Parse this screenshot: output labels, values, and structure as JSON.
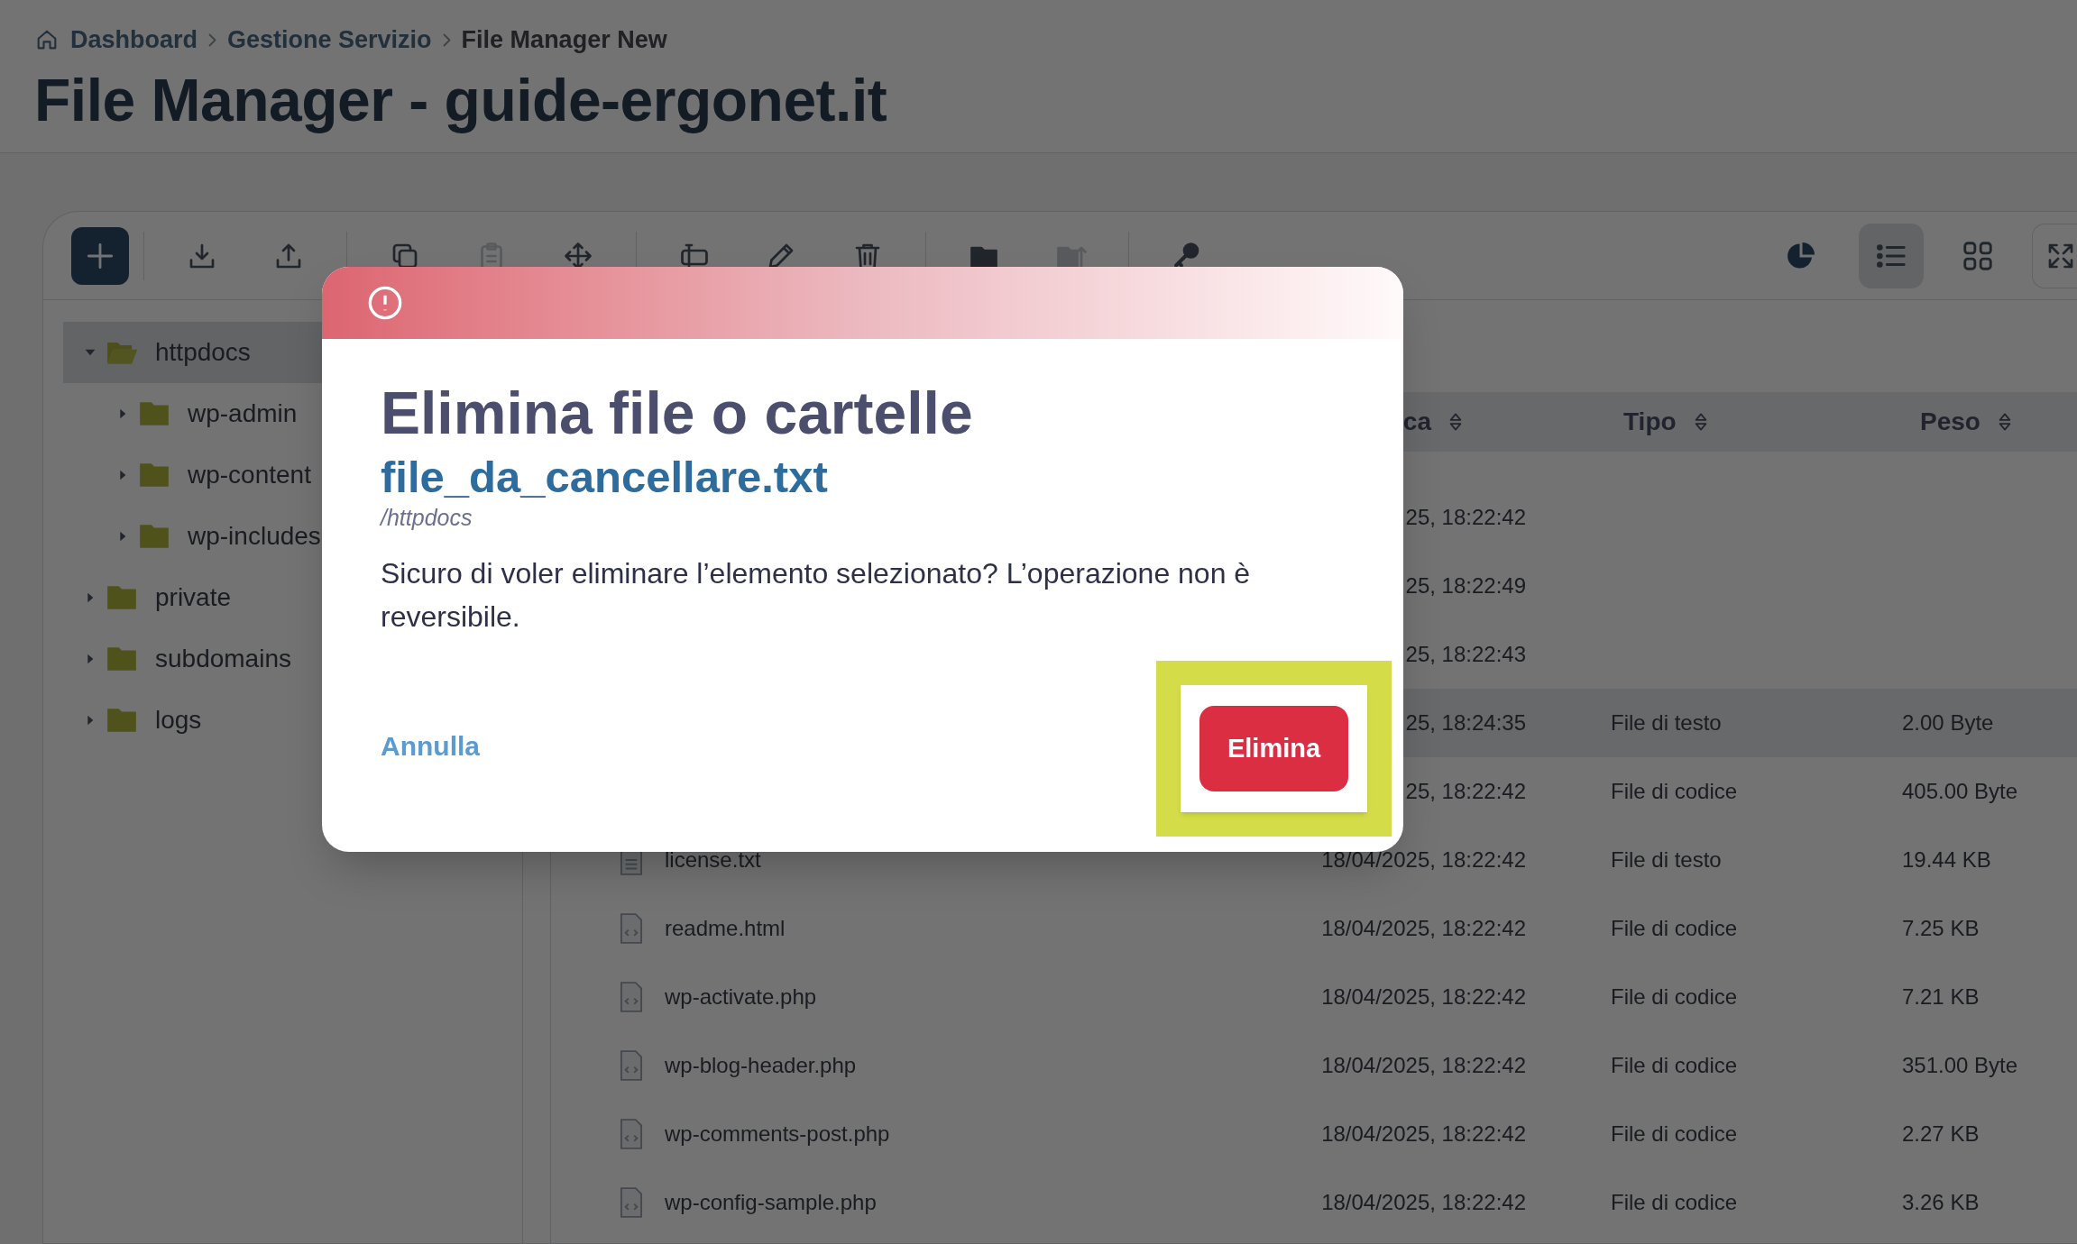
{
  "breadcrumb": [
    {
      "label": "Dashboard",
      "kind": "link"
    },
    {
      "label": "Gestione Servizio",
      "kind": "link"
    },
    {
      "label": "File Manager New",
      "kind": "current"
    }
  ],
  "page_title": "File Manager - guide-ergonet.it",
  "toolbar": {
    "groups": [
      [
        {
          "disabled": false
        },
        {
          "disabled": false
        }
      ],
      [
        {
          "disabled": false
        },
        {
          "disabled": true
        },
        {
          "disabled": false
        }
      ],
      [
        {
          "disabled": false
        },
        {
          "disabled": false
        },
        {
          "disabled": false
        }
      ],
      [
        {
          "disabled": false
        },
        {
          "disabled": true
        }
      ],
      [
        {
          "disabled": false
        }
      ]
    ],
    "views": [
      {
        "selected": true
      },
      {
        "selected": false
      }
    ]
  },
  "tree": [
    {
      "label": "httpdocs",
      "expanded": true,
      "selected": true,
      "children": [
        {
          "label": "wp-admin",
          "expanded": false,
          "selected": false
        },
        {
          "label": "wp-content",
          "expanded": false,
          "selected": false
        },
        {
          "label": "wp-includes",
          "expanded": false,
          "selected": false
        }
      ]
    },
    {
      "label": "private",
      "expanded": false,
      "selected": false
    },
    {
      "label": "subdomains",
      "expanded": false,
      "selected": false
    },
    {
      "label": "logs",
      "expanded": false,
      "selected": false
    }
  ],
  "table": {
    "columns": [
      {
        "label": "ca"
      },
      {
        "label": "Tipo"
      },
      {
        "label": "Peso"
      }
    ],
    "rows": [
      {
        "modified": "25, 18:22:42",
        "selected": false
      },
      {
        "modified": "25, 18:22:49",
        "selected": false
      },
      {
        "modified": "25, 18:22:43",
        "selected": false
      },
      {
        "modified": "25, 18:24:35",
        "type": "File di testo",
        "size": "2.00 Byte",
        "selected": true
      },
      {
        "modified": "25, 18:22:42",
        "type": "File di codice",
        "size": "405.00 Byte",
        "selected": false
      },
      {
        "name": "license.txt",
        "kind": "text",
        "modified": "18/04/2025, 18:22:42",
        "type": "File di testo",
        "size": "19.44 KB",
        "selected": false
      },
      {
        "name": "readme.html",
        "kind": "code",
        "modified": "18/04/2025, 18:22:42",
        "type": "File di codice",
        "size": "7.25 KB",
        "selected": false
      },
      {
        "name": "wp-activate.php",
        "kind": "code",
        "modified": "18/04/2025, 18:22:42",
        "type": "File di codice",
        "size": "7.21 KB",
        "selected": false
      },
      {
        "name": "wp-blog-header.php",
        "kind": "code",
        "modified": "18/04/2025, 18:22:42",
        "type": "File di codice",
        "size": "351.00 Byte",
        "selected": false
      },
      {
        "name": "wp-comments-post.php",
        "kind": "code",
        "modified": "18/04/2025, 18:22:42",
        "type": "File di codice",
        "size": "2.27 KB",
        "selected": false
      },
      {
        "name": "wp-config-sample.php",
        "kind": "code",
        "modified": "18/04/2025, 18:22:42",
        "type": "File di codice",
        "size": "3.26 KB",
        "selected": false
      }
    ]
  },
  "dialog": {
    "title": "Elimina file o cartelle",
    "file_name": "file_da_cancellare.txt",
    "path": "/httpdocs",
    "message": "Sicuro di voler eliminare l’elemento selezionato? L’operazione non è reversibile.",
    "cancel": "Annulla",
    "confirm": "Elimina"
  }
}
